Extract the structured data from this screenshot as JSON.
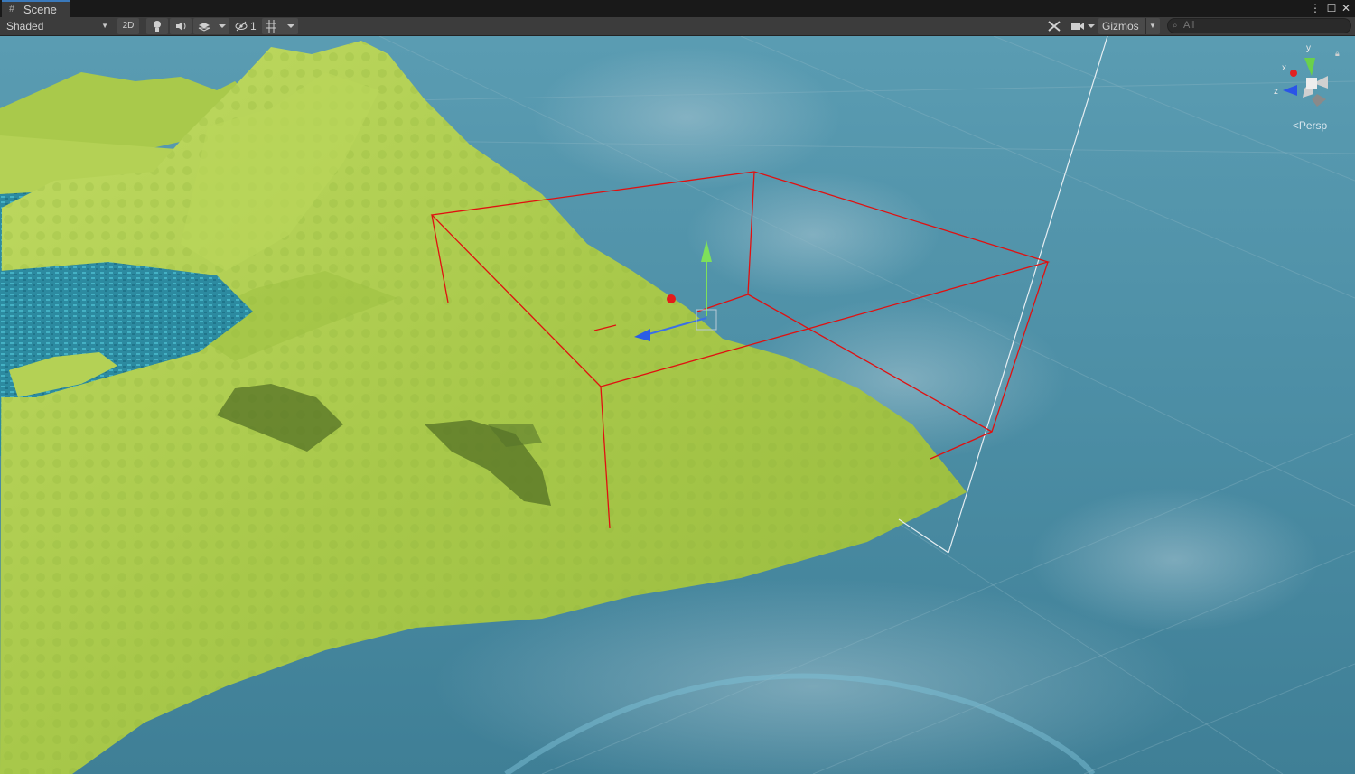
{
  "tab": {
    "icon": "grid-icon",
    "label": "Scene"
  },
  "window_controls": {
    "more": "⋮",
    "maximize": "☐",
    "close": "✕"
  },
  "toolbar": {
    "shading_mode": "Shaded",
    "mode_2d": "2D",
    "hidden_count": "1",
    "gizmos_label": "Gizmos",
    "search_placeholder": "All"
  },
  "orientation_gizmo": {
    "y_label": "y",
    "x_label": "x",
    "z_label": "z",
    "projection": "Persp"
  },
  "colors": {
    "accent": "#3a79bb",
    "toolbar": "#3c3c3c",
    "sky": "#4f8fa6",
    "terrain": "#a7c84a",
    "water": "#2f9bb0",
    "bounds": "#e01010"
  }
}
